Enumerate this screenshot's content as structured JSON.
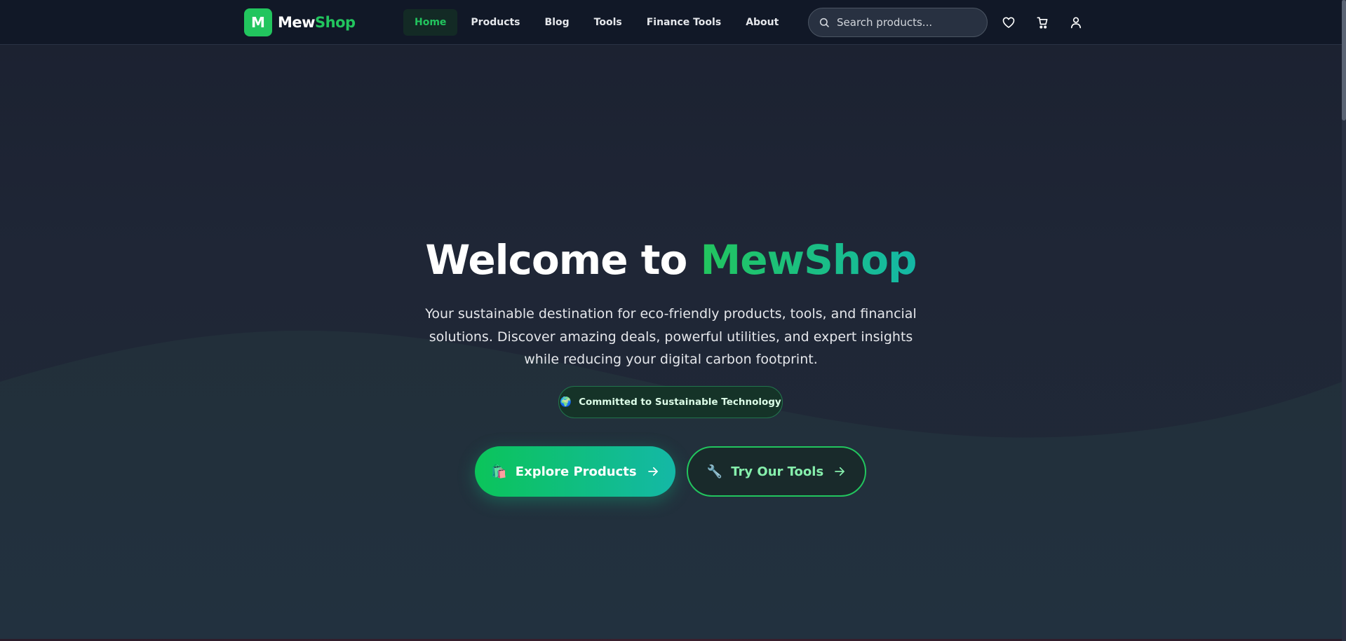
{
  "header": {
    "logo_letter": "M",
    "logo_text_a": "Mew",
    "logo_text_b": "Shop",
    "nav": [
      {
        "label": "Home",
        "active": true
      },
      {
        "label": "Products",
        "active": false
      },
      {
        "label": "Blog",
        "active": false
      },
      {
        "label": "Tools",
        "active": false
      },
      {
        "label": "Finance Tools",
        "active": false
      },
      {
        "label": "About",
        "active": false
      }
    ],
    "search": {
      "placeholder": "Search products...",
      "value": ""
    },
    "icons": [
      "heart-icon",
      "cart-icon",
      "user-icon"
    ]
  },
  "hero": {
    "title_prefix": "Welcome to ",
    "title_brand": "MewShop",
    "subtitle": "Your sustainable destination for eco-friendly products, tools, and financial solutions. Discover amazing deals, powerful utilities, and expert insights while reducing your digital carbon footprint.",
    "badge": {
      "icon": "🌍",
      "label": "Committed to Sustainable Technology"
    },
    "primary_button": {
      "icon": "🛍️",
      "label": "Explore Products"
    },
    "secondary_button": {
      "icon": "🔧",
      "label": "Try Our Tools"
    }
  },
  "colors": {
    "accent": "#22c55e",
    "accent_teal": "#14b8a6",
    "nav_bg": "#111827",
    "page_bg": "#1e2433"
  }
}
